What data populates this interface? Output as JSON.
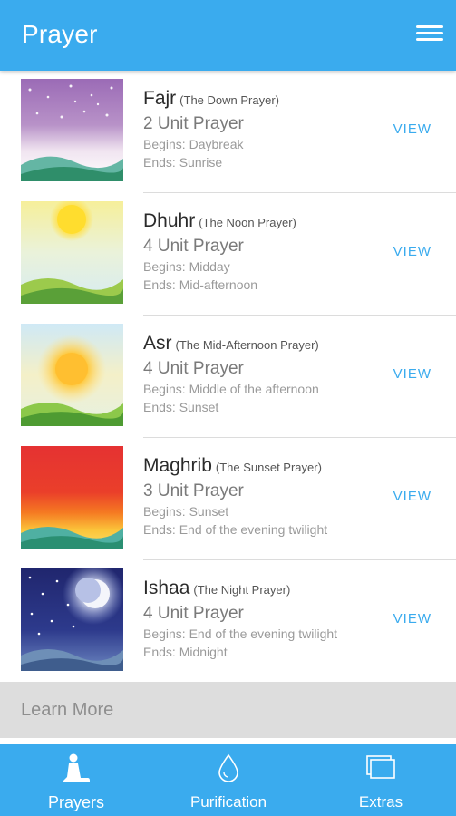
{
  "app_bar": {
    "title": "Prayer",
    "menu_icon": "hamburger-menu-icon"
  },
  "prayers": [
    {
      "name": "Fajr",
      "subtitle": "(The Down Prayer)",
      "units": "2 Unit Prayer",
      "begins": "Begins: Daybreak",
      "ends": "Ends: Sunrise",
      "action": "VIEW",
      "image": "dawn-sky-illustration"
    },
    {
      "name": "Dhuhr",
      "subtitle": "(The Noon Prayer)",
      "units": "4 Unit Prayer",
      "begins": "Begins: Midday",
      "ends": "Ends: Mid-afternoon",
      "action": "VIEW",
      "image": "noon-sun-illustration"
    },
    {
      "name": "Asr",
      "subtitle": "(The Mid-Afternoon Prayer)",
      "units": "4 Unit Prayer",
      "begins": "Begins: Middle of the afternoon",
      "ends": "Ends: Sunset",
      "action": "VIEW",
      "image": "afternoon-sun-illustration"
    },
    {
      "name": "Maghrib",
      "subtitle": "(The Sunset Prayer)",
      "units": "3 Unit Prayer",
      "begins": "Begins: Sunset",
      "ends": "Ends: End of the evening twilight",
      "action": "VIEW",
      "image": "sunset-sky-illustration"
    },
    {
      "name": "Ishaa",
      "subtitle": "(The Night Prayer)",
      "units": "4 Unit Prayer",
      "begins": "Begins: End of the evening twilight",
      "ends": "Ends: Midnight",
      "action": "VIEW",
      "image": "night-moon-illustration"
    }
  ],
  "learn_more": "Learn More",
  "bottom_nav": [
    {
      "label": "Prayers",
      "icon": "praying-person-icon",
      "active": true
    },
    {
      "label": "Purification",
      "icon": "water-drop-icon",
      "active": false
    },
    {
      "label": "Extras",
      "icon": "stacked-windows-icon",
      "active": false
    }
  ],
  "colors": {
    "primary": "#3aabee",
    "learn_more_bg": "#dddddd",
    "divider": "#dcdcdc"
  }
}
